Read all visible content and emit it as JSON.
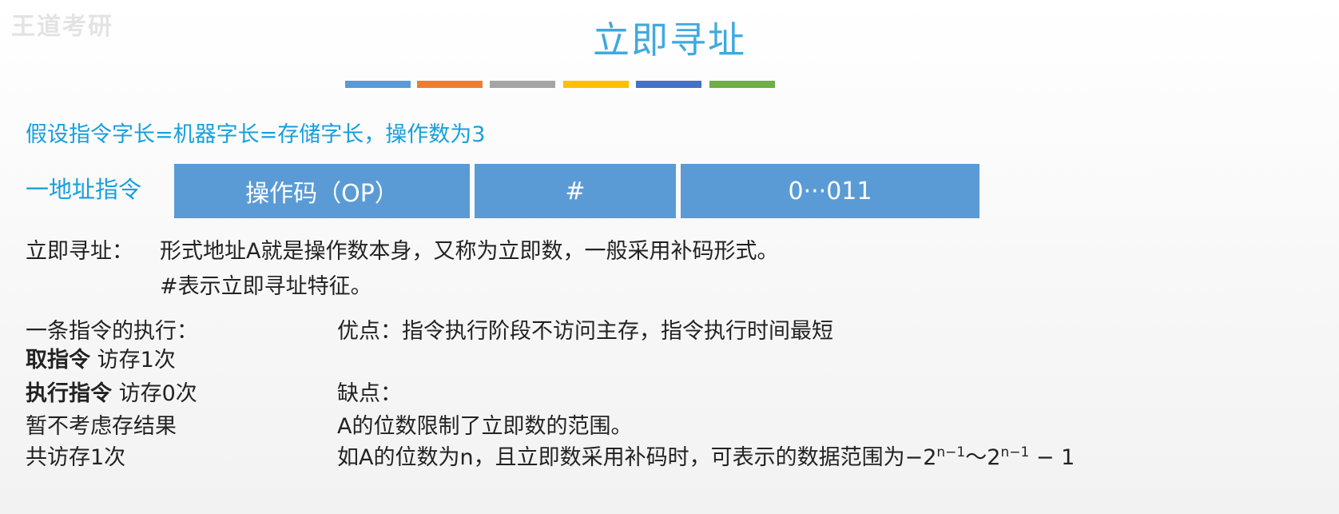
{
  "watermark": "王道考研",
  "title": "立即寻址",
  "color_bars": [
    "#5b9bd5",
    "#ed7d31",
    "#a5a5a5",
    "#ffc000",
    "#4472c4",
    "#70ad47"
  ],
  "assumption": "假设指令字长=机器字长=存储字长，操作数为3",
  "instruction": {
    "label": "一地址指令",
    "fields": [
      "操作码（OP）",
      "#",
      "0···011"
    ]
  },
  "definition": {
    "term": "立即寻址：",
    "text": "形式地址A就是操作数本身，又称为立即数，一般采用补码形式。",
    "note": "#表示立即寻址特征。"
  },
  "execution": {
    "heading": "一条指令的执行：",
    "fetch_bold": "取指令",
    "fetch_rest": " 访存1次",
    "exec_bold": "执行指令",
    "exec_rest": " 访存0次",
    "result": "暂不考虑存结果",
    "total": "共访存1次"
  },
  "pros": "优点：指令执行阶段不访问主存，指令执行时间最短",
  "cons": {
    "heading": "缺点：",
    "line1": "A的位数限制了立即数的范围。",
    "line2": "如A的位数为n，且立即数采用补码时，可表示的数据范围为",
    "formula_minus": "−2",
    "formula_exp": "n−1",
    "formula_tilde": "～2",
    "formula_tail": " − 1"
  }
}
